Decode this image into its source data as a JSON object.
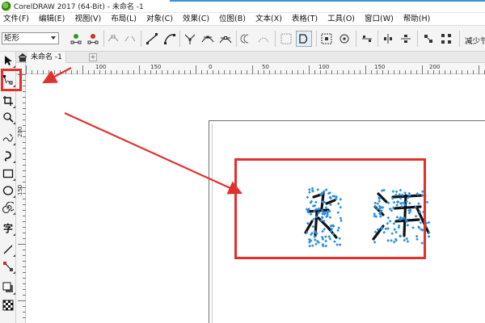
{
  "window": {
    "title": "CorelDRAW 2017 (64-Bit) - 未命名 -1"
  },
  "menu": [
    "文件(F)",
    "编辑(E)",
    "视图(V)",
    "布局(L)",
    "对象(C)",
    "效果(C)",
    "位图(B)",
    "文本(X)",
    "表格(T)",
    "工具(O)",
    "窗口(W)",
    "帮助(H)"
  ],
  "property_bar": {
    "shape_type": "矩形",
    "reduce_nodes_label": "减少节"
  },
  "document": {
    "tab_label": "未命名 -1",
    "add_tab": "+"
  },
  "ruler": {
    "horizontal": [
      "100",
      "150",
      "0",
      "50",
      "100",
      "150",
      "200"
    ],
    "vertical": [
      "200",
      "150"
    ]
  },
  "artwork": {
    "text": "绿洲",
    "node_color": "#2a8fe0",
    "fill_color": "#111111"
  },
  "colors": {
    "annotation": "#e0312f",
    "accent": "#3b8fd6"
  },
  "icons": {
    "pick_tool": "pointer-arrow-icon",
    "shape_tool": "shape-node-icon",
    "crop_tool": "crop-icon",
    "zoom_tool": "zoom-icon",
    "freehand_tool": "freehand-icon",
    "artistic_media_tool": "artistic-media-icon",
    "rectangle_tool": "rectangle-icon",
    "ellipse_tool": "ellipse-icon",
    "spiral_tool": "spiral-icon",
    "text_tool": "字",
    "connector_tool": "connector-icon",
    "blend_tool": "blend-icon",
    "shadow_tool": "drop-shadow-icon",
    "pattern_tool": "checkerboard-icon"
  }
}
